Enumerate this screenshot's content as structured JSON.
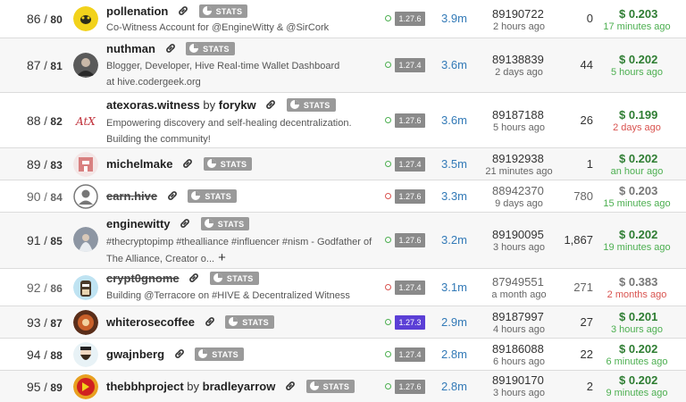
{
  "witnesses": [
    {
      "rank": "86",
      "active_rank": "80",
      "name": "pollenation",
      "by": "",
      "desc": "Co-Witness Account for @EngineWitty & @SirCork",
      "status": "on",
      "version": "1.27.6",
      "votes": "3.9m",
      "block": "89190722",
      "block_ago": "2 hours ago",
      "missed": "0",
      "price": "$ 0.203",
      "price_ago": "17 minutes ago",
      "price_status": "green",
      "avatar": "bee-avatar-icon",
      "stats_label": "STATS"
    },
    {
      "rank": "87",
      "active_rank": "81",
      "name": "nuthman",
      "by": "",
      "desc": "Blogger, Developer, Hive Real-time Wallet Dashboard at hive.codergeek.org",
      "status": "on",
      "version": "1.27.4",
      "votes": "3.6m",
      "block": "89138839",
      "block_ago": "2 days ago",
      "missed": "44",
      "price": "$ 0.202",
      "price_ago": "5 hours ago",
      "price_status": "green",
      "avatar": "person-avatar-icon",
      "stats_label": "STATS"
    },
    {
      "rank": "88",
      "active_rank": "82",
      "name": "atexoras.witness",
      "by": "forykw",
      "desc": "Empowering discovery and self-healing decentralization. Building the community!",
      "status": "on",
      "version": "1.27.6",
      "votes": "3.6m",
      "block": "89187188",
      "block_ago": "5 hours ago",
      "missed": "26",
      "price": "$ 0.199",
      "price_ago": "2 days ago",
      "price_status": "red",
      "avatar": "atx-logo-icon",
      "stats_label": "STATS"
    },
    {
      "rank": "89",
      "active_rank": "83",
      "name": "michelmake",
      "by": "",
      "desc": "",
      "status": "on",
      "version": "1.27.4",
      "votes": "3.5m",
      "block": "89192938",
      "block_ago": "21 minutes ago",
      "missed": "1",
      "price": "$ 0.202",
      "price_ago": "an hour ago",
      "price_status": "green",
      "avatar": "pixel-avatar-icon",
      "stats_label": "STATS"
    },
    {
      "rank": "90",
      "active_rank": "84",
      "name": "earn.hive",
      "by": "",
      "desc": "",
      "status": "off",
      "version": "1.27.6",
      "votes": "3.3m",
      "block": "88942370",
      "block_ago": "9 days ago",
      "missed": "780",
      "price": "$ 0.203",
      "price_ago": "15 minutes ago",
      "price_status": "green",
      "avatar": "default-user-icon",
      "stats_label": "STATS",
      "inactive": true
    },
    {
      "rank": "91",
      "active_rank": "85",
      "name": "enginewitty",
      "by": "",
      "desc": "#thecryptopimp #thealliance #influencer #nism - Godfather of The Alliance, Creator o...",
      "status": "on",
      "version": "1.27.6",
      "votes": "3.2m",
      "block": "89190095",
      "block_ago": "3 hours ago",
      "missed": "1,867",
      "price": "$ 0.202",
      "price_ago": "19 minutes ago",
      "price_status": "green",
      "avatar": "wizard-avatar-icon",
      "stats_label": "STATS"
    },
    {
      "rank": "92",
      "active_rank": "86",
      "name": "crypt0gnome",
      "by": "",
      "desc": "Building @Terracore on #HIVE & Decentralized Witness Operator",
      "status": "off",
      "version": "1.27.4",
      "votes": "3.1m",
      "block": "87949551",
      "block_ago": "a month ago",
      "missed": "271",
      "price": "$ 0.383",
      "price_ago": "2 months ago",
      "price_status": "red",
      "avatar": "gnome-avatar-icon",
      "stats_label": "STATS",
      "inactive": true
    },
    {
      "rank": "93",
      "active_rank": "87",
      "name": "whiterosecoffee",
      "by": "",
      "desc": "",
      "status": "on",
      "version": "1.27.3",
      "votes": "2.9m",
      "block": "89187997",
      "block_ago": "4 hours ago",
      "missed": "27",
      "price": "$ 0.201",
      "price_ago": "3 hours ago",
      "price_status": "green",
      "avatar": "coffee-avatar-icon",
      "stats_label": "STATS",
      "version_new": true
    },
    {
      "rank": "94",
      "active_rank": "88",
      "name": "gwajnberg",
      "by": "",
      "desc": "",
      "status": "on",
      "version": "1.27.4",
      "votes": "2.8m",
      "block": "89186088",
      "block_ago": "6 hours ago",
      "missed": "22",
      "price": "$ 0.202",
      "price_ago": "6 minutes ago",
      "price_status": "green",
      "avatar": "beard-avatar-icon",
      "stats_label": "STATS"
    },
    {
      "rank": "95",
      "active_rank": "89",
      "name": "thebbhproject",
      "by": "bradleyarrow",
      "desc": "",
      "status": "on",
      "version": "1.27.6",
      "votes": "2.8m",
      "block": "89190170",
      "block_ago": "3 hours ago",
      "missed": "2",
      "price": "$ 0.202",
      "price_ago": "9 minutes ago",
      "price_status": "green",
      "avatar": "bbh-logo-icon",
      "stats_label": "STATS"
    }
  ],
  "by_word": "by",
  "expand_symbol": "+"
}
